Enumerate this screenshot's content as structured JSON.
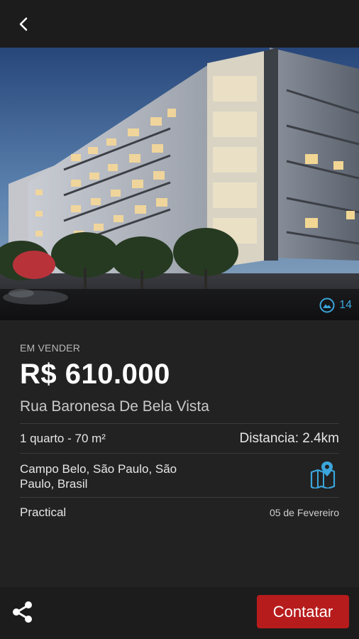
{
  "header": {
    "back_icon": "chevron-left-icon"
  },
  "listing": {
    "photo_icon": "landscape-icon",
    "photo_count": "14",
    "status": "EM VENDER",
    "price": "R$ 610.000",
    "address": "Rua Baronesa De Bela Vista",
    "rooms_area": "1 quarto - 70 m²",
    "distance": "Distancia: 2.4km",
    "location": "Campo Belo, São Paulo, São Paulo, Brasil",
    "map_icon": "map-pin-icon",
    "agency": "Practical",
    "date": "05 de Fevereiro"
  },
  "footer": {
    "share_icon": "share-icon",
    "contact_label": "Contatar"
  },
  "colors": {
    "accent": "#3aa6dc",
    "contact_button": "#b71c1c",
    "background": "#222222",
    "bar": "#1c1c1c"
  }
}
